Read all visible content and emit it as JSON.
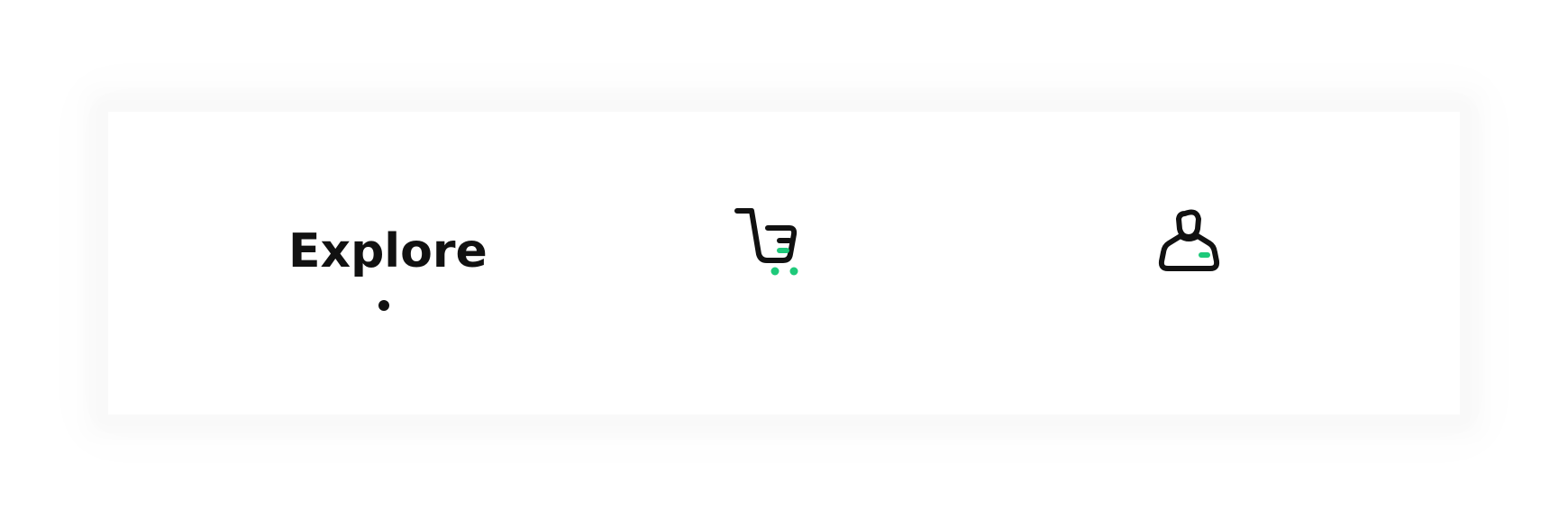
{
  "tabbar": {
    "tabs": [
      {
        "label": "Explore",
        "active": true
      },
      {
        "icon": "shopping-cart-icon",
        "active": false
      },
      {
        "icon": "user-profile-icon",
        "active": false
      }
    ]
  },
  "colors": {
    "text": "#111111",
    "accent": "#1ec97a",
    "background": "#ffffff"
  }
}
